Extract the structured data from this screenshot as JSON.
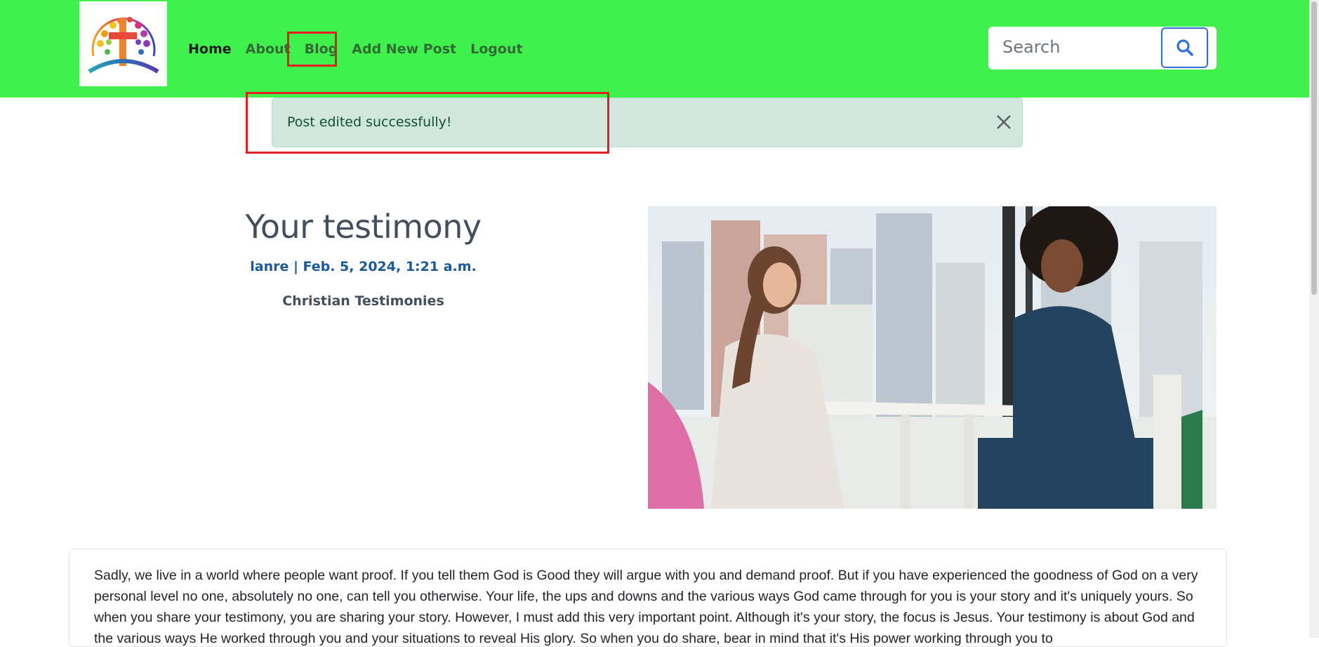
{
  "nav": {
    "logo_alt": "Christian testimonies logo",
    "links": [
      {
        "label": "Home",
        "active": true
      },
      {
        "label": "About",
        "active": false
      },
      {
        "label": "Blog",
        "active": false
      },
      {
        "label": "Add New Post",
        "active": false
      },
      {
        "label": "Logout",
        "active": false
      }
    ],
    "search": {
      "placeholder": "Search",
      "value": ""
    },
    "search_icon": "search-icon"
  },
  "alert": {
    "message": "Post edited successfully!",
    "close_icon": "close-icon",
    "status_color": "#d1e7dd"
  },
  "post": {
    "title": "Your testimony",
    "meta": "lanre | Feb. 5, 2024, 1:21 a.m.",
    "category": "Christian Testimonies",
    "image": "two-women-talking-at-table"
  },
  "content": {
    "body": "Sadly, we live in a world where people want proof. If you tell them God is Good they will argue with you and demand proof. But if you have experienced the goodness of God on a very personal level no one, absolutely no one, can tell you otherwise. Your life, the ups and downs and the various ways God came through for you is your story and it's uniquely yours. So when you share your testimony, you are sharing your story. However, I must add this very important point. Although it's your story, the focus is Jesus. Your testimony is about God and the various ways He worked through you and your situations to reveal His glory. So when you do share, bear in mind that it's His power working through you to"
  },
  "colors": {
    "navbar": "#40f04c",
    "highlight": "#e02020",
    "title": "#444e5d",
    "meta": "#1a5899"
  }
}
